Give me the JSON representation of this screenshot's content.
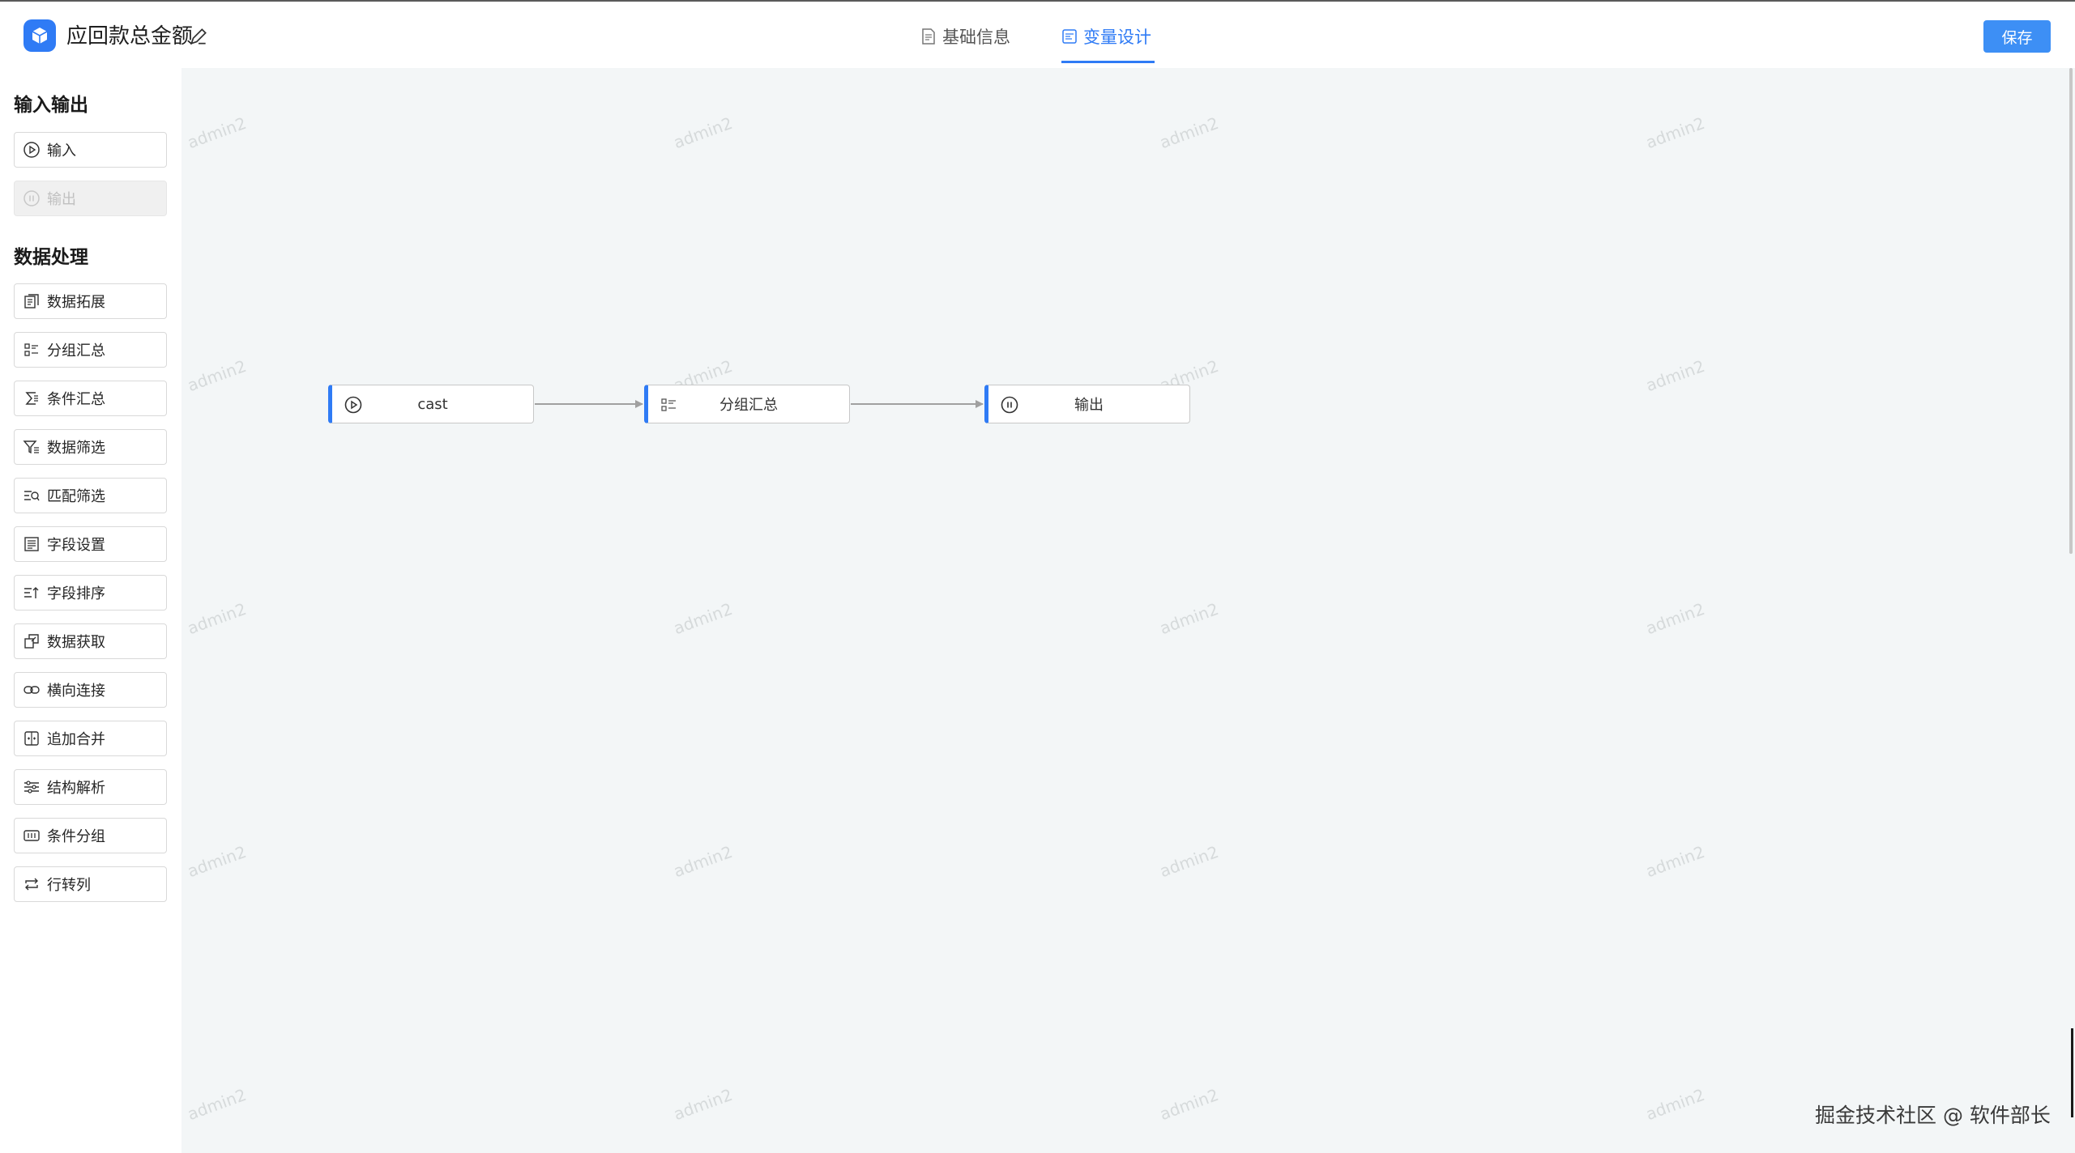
{
  "header": {
    "title": "应回款总金额",
    "tabs": [
      {
        "label": "基础信息",
        "active": false
      },
      {
        "label": "变量设计",
        "active": true
      }
    ],
    "save_label": "保存"
  },
  "sidebar": {
    "io_title": "输入输出",
    "io_items": [
      {
        "label": "输入",
        "icon": "play-circle-icon",
        "disabled": false
      },
      {
        "label": "输出",
        "icon": "pause-circle-icon",
        "disabled": true
      }
    ],
    "processing_title": "数据处理",
    "processing_items": [
      {
        "label": "数据拓展",
        "icon": "copy-icon"
      },
      {
        "label": "分组汇总",
        "icon": "group-list-icon"
      },
      {
        "label": "条件汇总",
        "icon": "sigma-icon"
      },
      {
        "label": "数据筛选",
        "icon": "filter-icon"
      },
      {
        "label": "匹配筛选",
        "icon": "search-list-icon"
      },
      {
        "label": "字段设置",
        "icon": "field-table-icon"
      },
      {
        "label": "字段排序",
        "icon": "sort-icon"
      },
      {
        "label": "数据获取",
        "icon": "fetch-icon"
      },
      {
        "label": "横向连接",
        "icon": "link-icon"
      },
      {
        "label": "追加合并",
        "icon": "merge-icon"
      },
      {
        "label": "结构解析",
        "icon": "sliders-icon"
      },
      {
        "label": "条件分组",
        "icon": "condition-group-icon"
      },
      {
        "label": "行转列",
        "icon": "swap-icon"
      }
    ]
  },
  "canvas": {
    "watermark": "admin2",
    "nodes": [
      {
        "label": "cast",
        "icon": "play-circle-icon"
      },
      {
        "label": "分组汇总",
        "icon": "group-list-icon"
      },
      {
        "label": "输出",
        "icon": "pause-circle-icon"
      }
    ]
  },
  "footer": {
    "text": "掘金技术社区 @ 软件部长"
  },
  "colors": {
    "accent": "#2f7bf5",
    "save_button": "#3d8ff5",
    "canvas_bg": "#f3f6f7"
  }
}
